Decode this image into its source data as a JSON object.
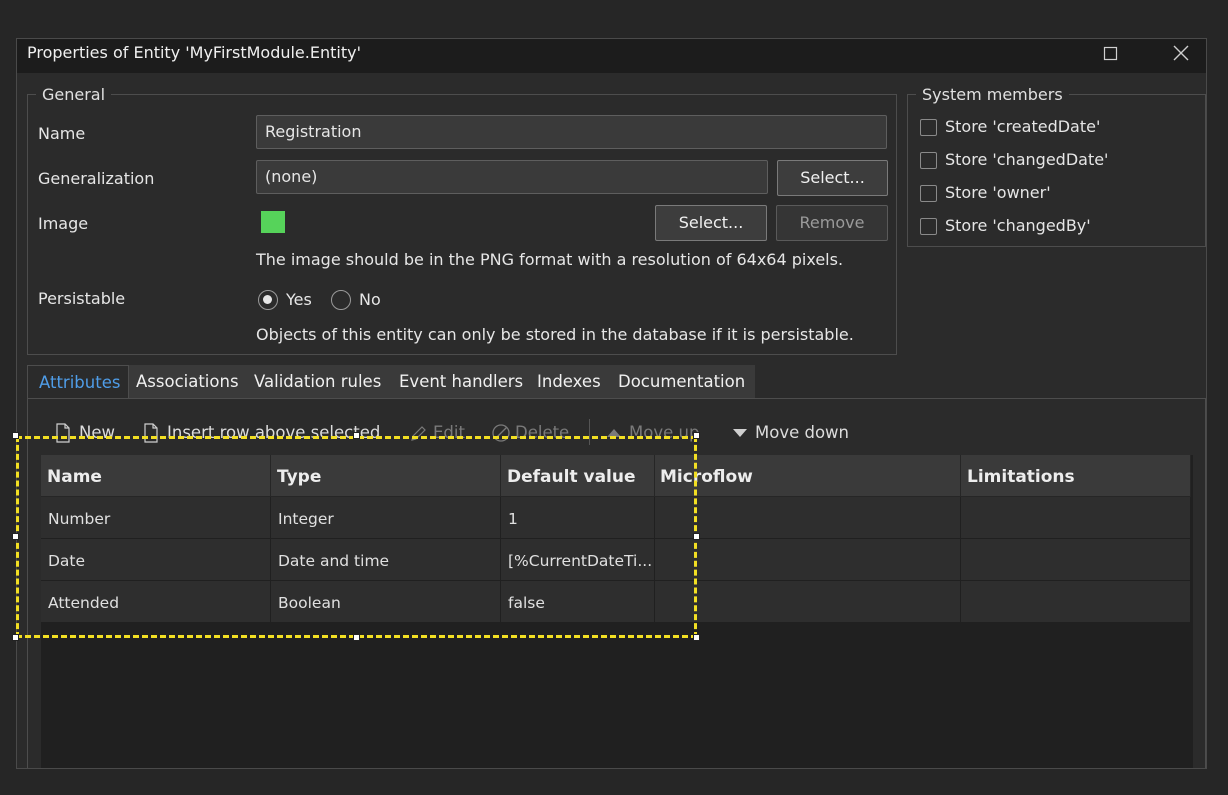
{
  "window": {
    "title": "Properties of Entity 'MyFirstModule.Entity'",
    "maximize_icon": "square-icon",
    "close_icon": "close-icon"
  },
  "general": {
    "legend": "General",
    "name_label": "Name",
    "name_value": "Registration",
    "generalization_label": "Generalization",
    "generalization_value": "(none)",
    "generalization_select_label": "Select...",
    "image_label": "Image",
    "image_swatch_color": "#56d35a",
    "image_select_label": "Select...",
    "image_remove_label": "Remove",
    "image_hint": "The image should be in the PNG format with a resolution of 64x64 pixels.",
    "persistable_label": "Persistable",
    "persistable_yes": "Yes",
    "persistable_no": "No",
    "persistable_selected": "Yes",
    "persistable_hint": "Objects of this entity can only be stored in the database if it is persistable."
  },
  "system_members": {
    "legend": "System members",
    "items": [
      {
        "label": "Store 'createdDate'",
        "checked": false
      },
      {
        "label": "Store 'changedDate'",
        "checked": false
      },
      {
        "label": "Store 'owner'",
        "checked": false
      },
      {
        "label": "Store 'changedBy'",
        "checked": false
      }
    ]
  },
  "tabs": [
    {
      "label": "Attributes",
      "active": true
    },
    {
      "label": "Associations",
      "active": false
    },
    {
      "label": "Validation rules",
      "active": false
    },
    {
      "label": "Event handlers",
      "active": false
    },
    {
      "label": "Indexes",
      "active": false
    },
    {
      "label": "Documentation",
      "active": false
    }
  ],
  "toolbar": {
    "new_label": "New",
    "insert_label": "Insert row above selected",
    "edit_label": "Edit",
    "delete_label": "Delete",
    "move_up_label": "Move up",
    "move_down_label": "Move down"
  },
  "table": {
    "columns": [
      "Name",
      "Type",
      "Default value",
      "Microflow",
      "Limitations"
    ],
    "rows": [
      [
        "Number",
        "Integer",
        "1",
        "",
        ""
      ],
      [
        "Date",
        "Date and time",
        "[%CurrentDateTi...",
        "",
        ""
      ],
      [
        "Attended",
        "Boolean",
        "false",
        "",
        ""
      ]
    ]
  },
  "colors": {
    "accent": "#4f9de8",
    "highlight": "#f2df23"
  }
}
